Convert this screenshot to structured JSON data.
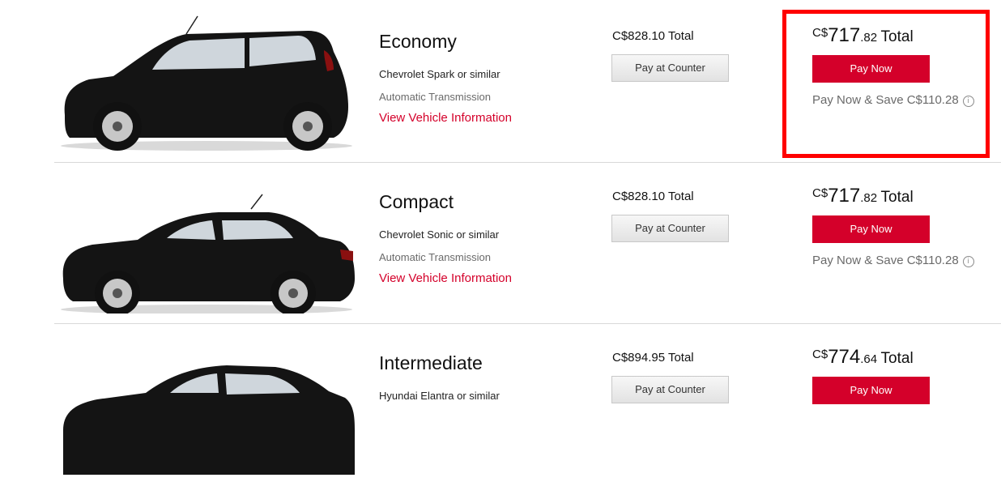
{
  "colors": {
    "accent": "#d4002a",
    "highlight": "#ff0000",
    "muted": "#6a6a6a"
  },
  "vehicles": [
    {
      "class_name": "Economy",
      "model": "Chevrolet Spark or similar",
      "transmission": "Automatic Transmission",
      "info_link": "View Vehicle Information",
      "counter_total": "C$828.10 Total",
      "counter_button": "Pay at Counter",
      "now_currency": "C$",
      "now_whole": "717",
      "now_cents": ".82",
      "now_total_label": "Total",
      "pay_now_button": "Pay Now",
      "save_text": "Pay Now & Save C$110.28",
      "info_icon": "i"
    },
    {
      "class_name": "Compact",
      "model": "Chevrolet Sonic or similar",
      "transmission": "Automatic Transmission",
      "info_link": "View Vehicle Information",
      "counter_total": "C$828.10 Total",
      "counter_button": "Pay at Counter",
      "now_currency": "C$",
      "now_whole": "717",
      "now_cents": ".82",
      "now_total_label": "Total",
      "pay_now_button": "Pay Now",
      "save_text": "Pay Now & Save C$110.28",
      "info_icon": "i"
    },
    {
      "class_name": "Intermediate",
      "model": "Hyundai Elantra or similar",
      "counter_total": "C$894.95 Total",
      "counter_button": "Pay at Counter",
      "now_currency": "C$",
      "now_whole": "774",
      "now_cents": ".64",
      "now_total_label": "Total",
      "pay_now_button": "Pay Now"
    }
  ]
}
